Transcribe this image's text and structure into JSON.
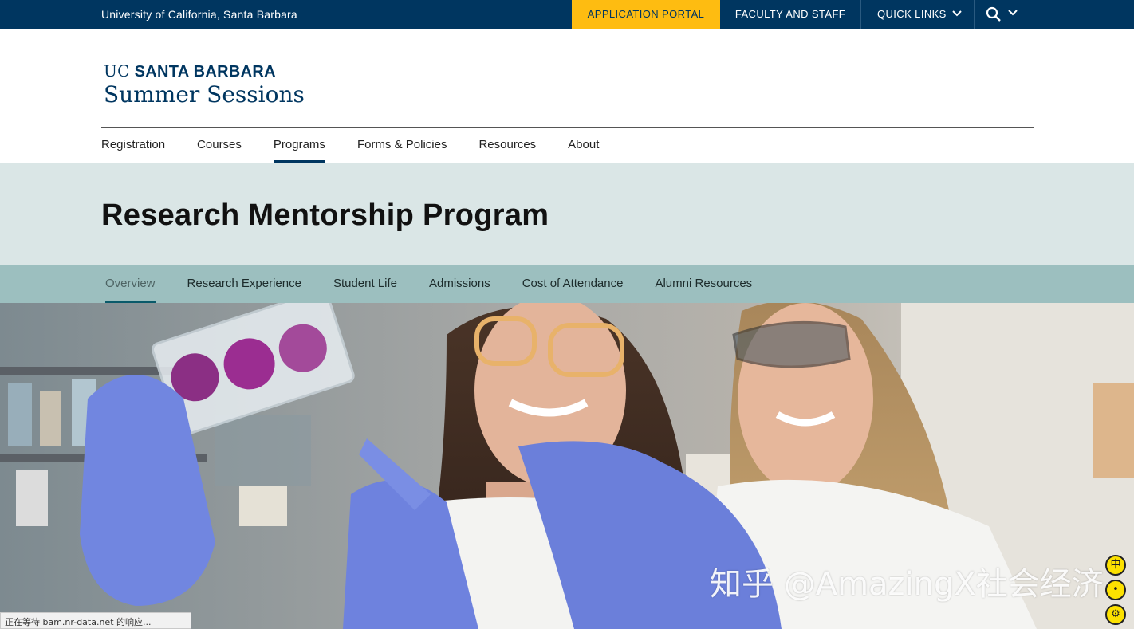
{
  "topbar": {
    "university": "University of California, Santa Barbara",
    "portal_label": "APPLICATION PORTAL",
    "faculty_label": "FACULTY AND STAFF",
    "quick_links_label": "QUICK LINKS"
  },
  "logo": {
    "uc": "UC",
    "santa_barbara": "SANTA BARBARA",
    "department": "Summer Sessions"
  },
  "mainnav": {
    "items": [
      {
        "label": "Registration"
      },
      {
        "label": "Courses"
      },
      {
        "label": "Programs",
        "active": true
      },
      {
        "label": "Forms & Policies"
      },
      {
        "label": "Resources"
      },
      {
        "label": "About"
      }
    ]
  },
  "page": {
    "title": "Research Mentorship Program"
  },
  "subnav": {
    "items": [
      {
        "label": "Overview",
        "active": true
      },
      {
        "label": "Research Experience"
      },
      {
        "label": "Student Life"
      },
      {
        "label": "Admissions"
      },
      {
        "label": "Cost of Attendance"
      },
      {
        "label": "Alumni Resources"
      }
    ]
  },
  "watermark": {
    "text": "知乎 @AmazingX社会经济"
  },
  "side_widget": {
    "icons": [
      "中",
      "•",
      "⚙"
    ]
  },
  "statusbar": {
    "text": "正在等待 bam.nr-data.net 的响应..."
  },
  "colors": {
    "navy": "#003660",
    "gold": "#febc11",
    "title_band": "#dae6e6",
    "subnav_band": "#9cbfbf"
  }
}
